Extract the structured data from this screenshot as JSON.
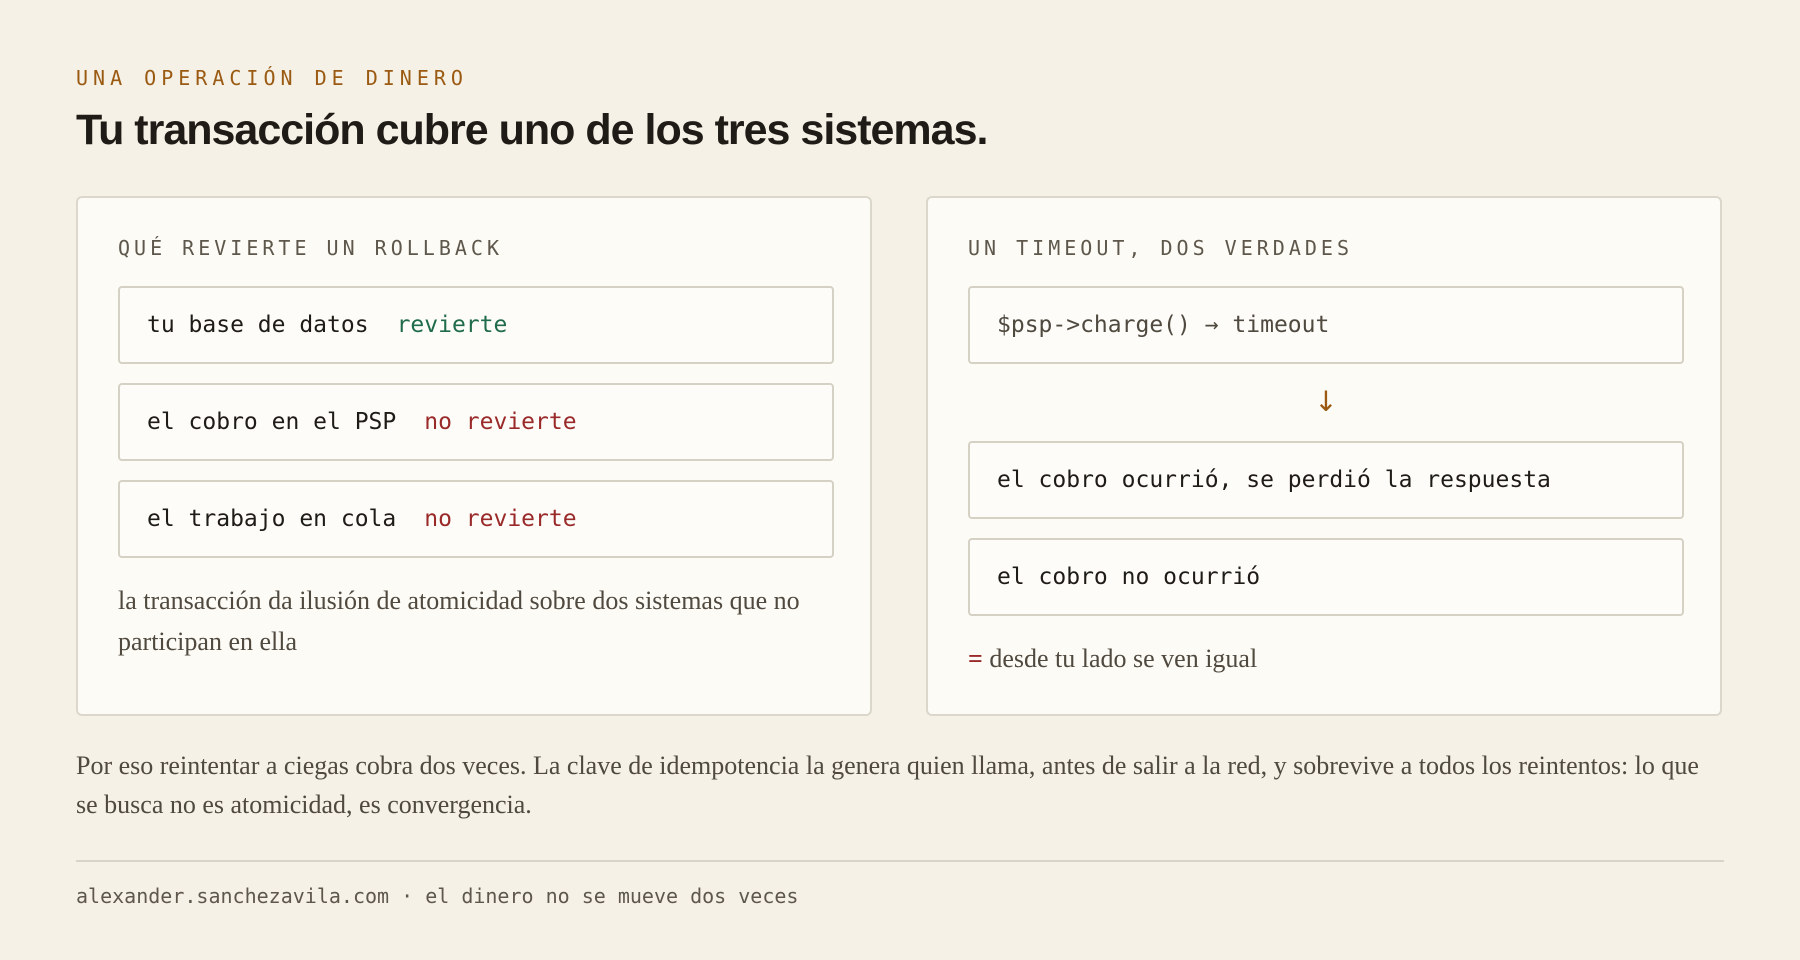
{
  "header": {
    "eyebrow": "UNA OPERACIÓN DE DINERO",
    "title": "Tu transacción cubre uno de los tres sistemas."
  },
  "rollback_card": {
    "heading": "QUÉ REVIERTE UN ROLLBACK",
    "rows": [
      {
        "label": "tu base de datos",
        "status": "revierte",
        "status_kind": "ok"
      },
      {
        "label": "el cobro en el PSP",
        "status": "no revierte",
        "status_kind": "bad"
      },
      {
        "label": "el trabajo en cola",
        "status": "no revierte",
        "status_kind": "bad"
      }
    ],
    "note": "la transacción da ilusión de atomicidad sobre dos sistemas que no participan en ella"
  },
  "timeout_card": {
    "heading": "UN TIMEOUT, DOS VERDADES",
    "call": "$psp->charge() → timeout",
    "arrow": "↓",
    "outcomes": [
      "el cobro ocurrió, se perdió la respuesta",
      "el cobro no ocurrió"
    ],
    "note_symbol": "=",
    "note_text": " desde tu lado se ven igual"
  },
  "body": {
    "paragraph": "Por eso reintentar a ciegas cobra dos veces. La clave de idempotencia la genera quien llama, antes de salir a la red, y sobrevive a todos los reintentos: lo que se busca no es atomicidad, es convergencia."
  },
  "footer": {
    "text": "alexander.sanchezavila.com · el dinero no se mueve dos veces"
  },
  "colors": {
    "background": "#f5f1e6",
    "accent": "#9a5a12",
    "ok": "#1f6b4a",
    "bad": "#9a2a2a"
  }
}
